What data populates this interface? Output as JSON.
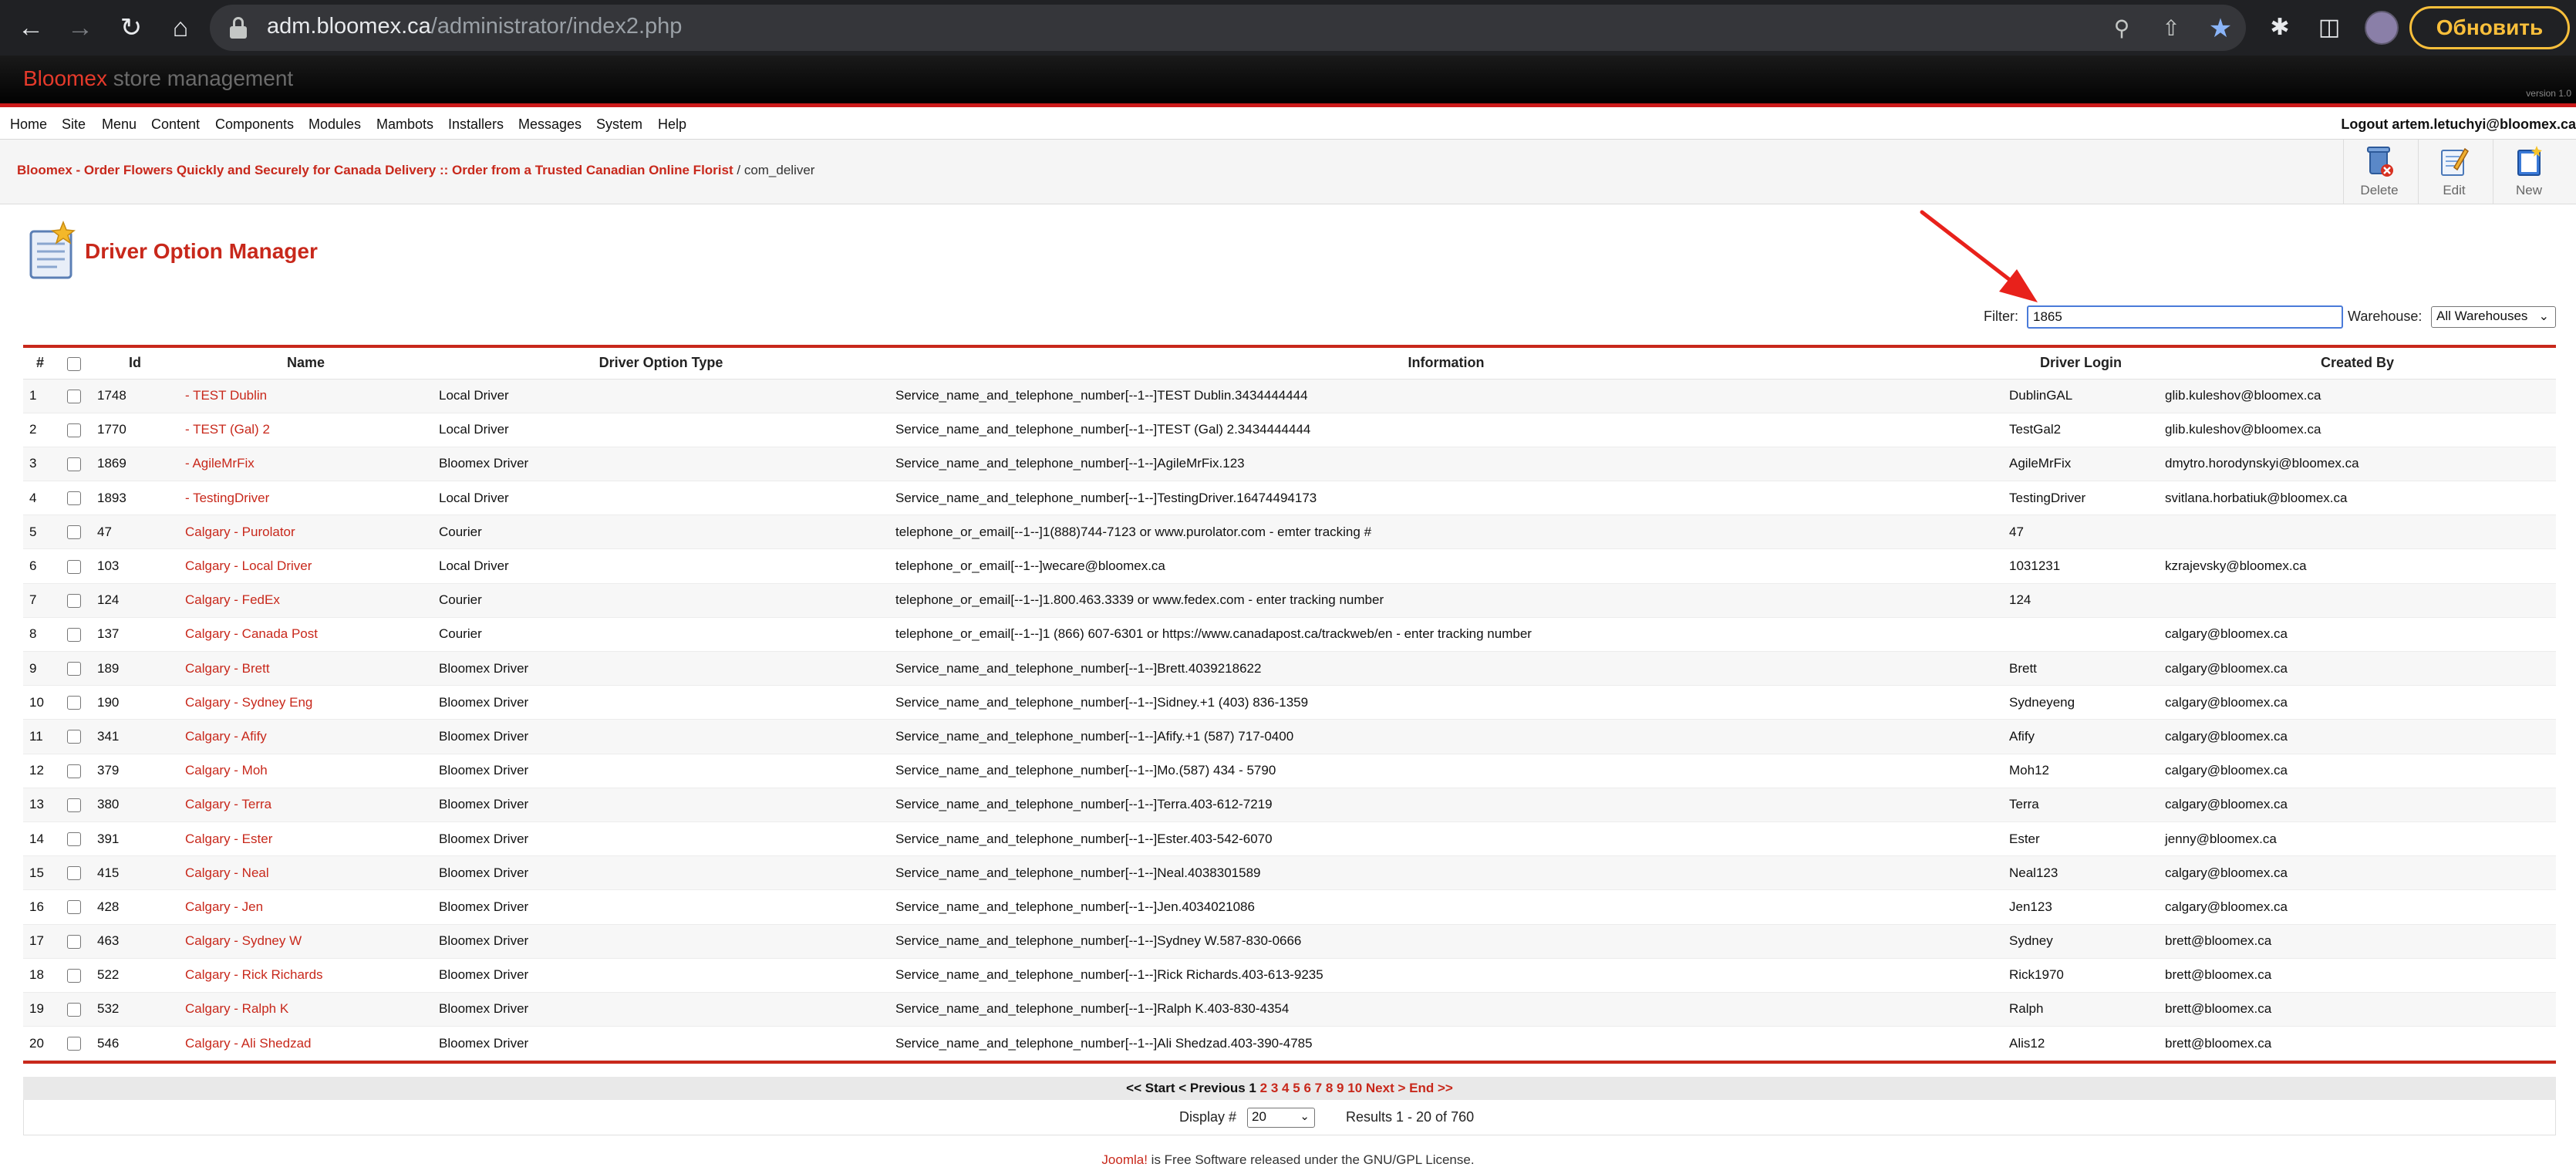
{
  "browser": {
    "url_host": "adm.bloomex.ca",
    "url_path": "/administrator/index2.php",
    "update_button": "Обновить"
  },
  "header": {
    "brand": "Bloomex",
    "rest": " store management",
    "version": "version 1.0"
  },
  "menu": {
    "items": [
      "Home",
      "Site",
      "Menu",
      "Content",
      "Components",
      "Modules",
      "Mambots",
      "Installers",
      "Messages",
      "System",
      "Help"
    ],
    "logout": "Logout artem.letuchyi@bloomex.ca"
  },
  "breadcrumb": {
    "site": "Bloomex - Order Flowers Quickly and Securely for Canada Delivery :: Order from a Trusted Canadian Online Florist",
    "separator": " / ",
    "component": "com_deliver"
  },
  "toolbar": {
    "delete": "Delete",
    "edit": "Edit",
    "new": "New"
  },
  "page": {
    "title": "Driver Option Manager"
  },
  "filter": {
    "label": "Filter:",
    "value": "1865",
    "warehouse_label": "Warehouse:",
    "warehouse_value": "All Warehouses"
  },
  "table": {
    "headers": {
      "num": "#",
      "id": "Id",
      "name": "Name",
      "type": "Driver Option Type",
      "info": "Information",
      "login": "Driver Login",
      "created": "Created By"
    },
    "rows": [
      {
        "num": "1",
        "id": "1748",
        "name": "- TEST Dublin",
        "type": "Local Driver",
        "info": "Service_name_and_telephone_number[--1--]TEST Dublin.3434444444",
        "login": "DublinGAL",
        "created": "glib.kuleshov@bloomex.ca"
      },
      {
        "num": "2",
        "id": "1770",
        "name": "- TEST (Gal) 2",
        "type": "Local Driver",
        "info": "Service_name_and_telephone_number[--1--]TEST (Gal) 2.3434444444",
        "login": "TestGal2",
        "created": "glib.kuleshov@bloomex.ca"
      },
      {
        "num": "3",
        "id": "1869",
        "name": "- AgileMrFix",
        "type": "Bloomex Driver",
        "info": "Service_name_and_telephone_number[--1--]AgileMrFix.123",
        "login": "AgileMrFix",
        "created": "dmytro.horodynskyi@bloomex.ca"
      },
      {
        "num": "4",
        "id": "1893",
        "name": "- TestingDriver",
        "type": "Local Driver",
        "info": "Service_name_and_telephone_number[--1--]TestingDriver.16474494173",
        "login": "TestingDriver",
        "created": "svitlana.horbatiuk@bloomex.ca"
      },
      {
        "num": "5",
        "id": "47",
        "name": "Calgary - Purolator",
        "type": "Courier",
        "info": "telephone_or_email[--1--]1(888)744-7123 or www.purolator.com - emter tracking #",
        "login": "47",
        "created": ""
      },
      {
        "num": "6",
        "id": "103",
        "name": "Calgary - Local Driver",
        "type": "Local Driver",
        "info": "telephone_or_email[--1--]wecare@bloomex.ca",
        "login": "1031231",
        "created": "kzrajevsky@bloomex.ca"
      },
      {
        "num": "7",
        "id": "124",
        "name": "Calgary - FedEx",
        "type": "Courier",
        "info": "telephone_or_email[--1--]1.800.463.3339 or www.fedex.com - enter tracking number",
        "login": "124",
        "created": ""
      },
      {
        "num": "8",
        "id": "137",
        "name": "Calgary - Canada Post",
        "type": "Courier",
        "info": "telephone_or_email[--1--]1 (866) 607-6301 or https://www.canadapost.ca/trackweb/en - enter tracking number",
        "login": "",
        "created": "calgary@bloomex.ca"
      },
      {
        "num": "9",
        "id": "189",
        "name": "Calgary - Brett",
        "type": "Bloomex Driver",
        "info": "Service_name_and_telephone_number[--1--]Brett.4039218622",
        "login": "Brett",
        "created": "calgary@bloomex.ca"
      },
      {
        "num": "10",
        "id": "190",
        "name": "Calgary - Sydney Eng",
        "type": "Bloomex Driver",
        "info": "Service_name_and_telephone_number[--1--]Sidney.+1 (403) 836-1359",
        "login": "Sydneyeng",
        "created": "calgary@bloomex.ca"
      },
      {
        "num": "11",
        "id": "341",
        "name": "Calgary - Afify",
        "type": "Bloomex Driver",
        "info": "Service_name_and_telephone_number[--1--]Afify.+1 (587) 717-0400",
        "login": "Afify",
        "created": "calgary@bloomex.ca"
      },
      {
        "num": "12",
        "id": "379",
        "name": "Calgary - Moh",
        "type": "Bloomex Driver",
        "info": "Service_name_and_telephone_number[--1--]Mo.(587) 434 - 5790",
        "login": "Moh12",
        "created": "calgary@bloomex.ca"
      },
      {
        "num": "13",
        "id": "380",
        "name": "Calgary - Terra",
        "type": "Bloomex Driver",
        "info": "Service_name_and_telephone_number[--1--]Terra.403-612-7219",
        "login": "Terra",
        "created": "calgary@bloomex.ca"
      },
      {
        "num": "14",
        "id": "391",
        "name": "Calgary - Ester",
        "type": "Bloomex Driver",
        "info": "Service_name_and_telephone_number[--1--]Ester.403-542-6070",
        "login": "Ester",
        "created": "jenny@bloomex.ca"
      },
      {
        "num": "15",
        "id": "415",
        "name": "Calgary - Neal",
        "type": "Bloomex Driver",
        "info": "Service_name_and_telephone_number[--1--]Neal.4038301589",
        "login": "Neal123",
        "created": "calgary@bloomex.ca"
      },
      {
        "num": "16",
        "id": "428",
        "name": "Calgary - Jen",
        "type": "Bloomex Driver",
        "info": "Service_name_and_telephone_number[--1--]Jen.4034021086",
        "login": "Jen123",
        "created": "calgary@bloomex.ca"
      },
      {
        "num": "17",
        "id": "463",
        "name": "Calgary - Sydney W",
        "type": "Bloomex Driver",
        "info": "Service_name_and_telephone_number[--1--]Sydney W.587-830-0666",
        "login": "Sydney",
        "created": "brett@bloomex.ca"
      },
      {
        "num": "18",
        "id": "522",
        "name": "Calgary - Rick Richards",
        "type": "Bloomex Driver",
        "info": "Service_name_and_telephone_number[--1--]Rick Richards.403-613-9235",
        "login": "Rick1970",
        "created": "brett@bloomex.ca"
      },
      {
        "num": "19",
        "id": "532",
        "name": "Calgary - Ralph K",
        "type": "Bloomex Driver",
        "info": "Service_name_and_telephone_number[--1--]Ralph K.403-830-4354",
        "login": "Ralph",
        "created": "brett@bloomex.ca"
      },
      {
        "num": "20",
        "id": "546",
        "name": "Calgary - Ali Shedzad",
        "type": "Bloomex Driver",
        "info": "Service_name_and_telephone_number[--1--]Ali Shedzad.403-390-4785",
        "login": "Alis12",
        "created": "brett@bloomex.ca"
      }
    ]
  },
  "pager": {
    "start": "<< Start",
    "previous": "< Previous",
    "current": "1",
    "pages": [
      "2",
      "3",
      "4",
      "5",
      "6",
      "7",
      "8",
      "9",
      "10"
    ],
    "next": "Next >",
    "end": "End >>",
    "display_label": "Display #",
    "display_value": "20",
    "results": "Results 1 - 20 of 760"
  },
  "footer": {
    "joomla": "Joomla!",
    "text": " is Free Software released under the GNU/GPL License."
  },
  "colors": {
    "accent": "#c8281b",
    "chrome_bg": "#202124",
    "update_yellow": "#f9bf3b",
    "focus_blue": "#4a7bd9"
  }
}
